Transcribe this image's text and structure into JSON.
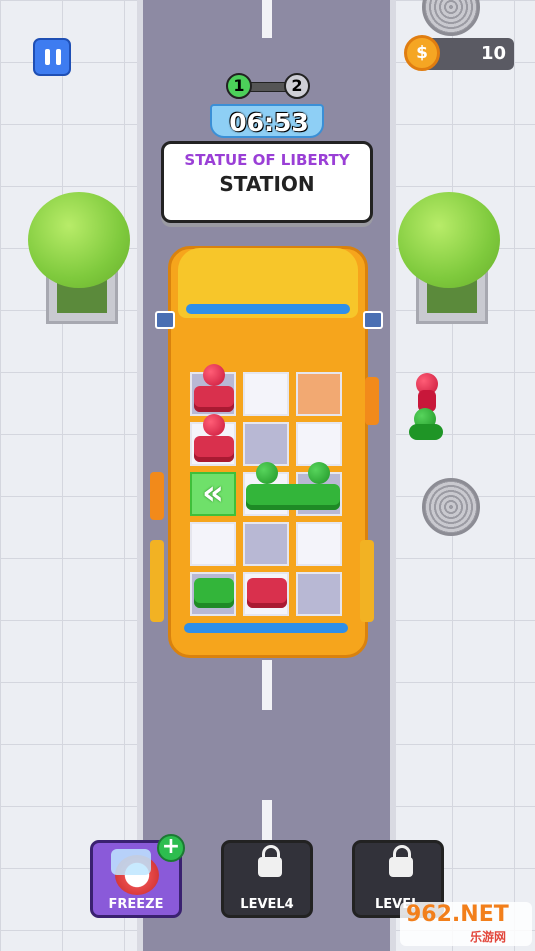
{
  "hud": {
    "coins": "10",
    "coin_symbol": "$",
    "level_steps": [
      "1",
      "2"
    ],
    "timer": "06:53"
  },
  "station": {
    "name": "STATUE OF LIBERTY",
    "label": "STATION"
  },
  "powerups": [
    {
      "label": "FREEZE",
      "state": "available",
      "badge": "+"
    },
    {
      "label": "LEVEL4",
      "state": "locked"
    },
    {
      "label": "LEVEL",
      "state": "locked"
    }
  ],
  "colors": {
    "red_seat": "#d9304d",
    "green_seat": "#33b53a",
    "bus": "#f6a51c",
    "accent_blue": "#3e7cf0",
    "freeze_purple": "#8a5ad9"
  },
  "watermark": {
    "domain": "962.NET",
    "sub": "乐游网"
  }
}
